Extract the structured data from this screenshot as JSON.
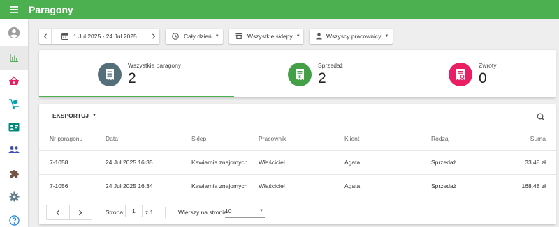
{
  "app": {
    "title": "Paragony"
  },
  "sidebar": {
    "items": [
      {
        "name": "account",
        "icon": "account-circle-icon",
        "active": false
      },
      {
        "name": "reports",
        "icon": "bar-chart-icon",
        "active": true
      },
      {
        "name": "sales",
        "icon": "shopping-basket-icon",
        "active": false
      },
      {
        "name": "delivery",
        "icon": "hand-truck-icon",
        "active": false
      },
      {
        "name": "customers",
        "icon": "contact-card-icon",
        "active": false
      },
      {
        "name": "employees",
        "icon": "people-icon",
        "active": false
      },
      {
        "name": "integrations",
        "icon": "puzzle-icon",
        "active": false
      },
      {
        "name": "settings",
        "icon": "gear-icon",
        "active": false
      },
      {
        "name": "help",
        "icon": "help-icon",
        "active": false
      }
    ]
  },
  "filters": {
    "date_range": "1 Jul 2025 - 24 Jul 2025",
    "time": "Cały dzień",
    "shops": "Wszystkie sklepy",
    "employees": "Wszyscy pracownicy"
  },
  "stats": {
    "all": {
      "label": "Wszystkie paragony",
      "value": "2",
      "color": "#546e7a"
    },
    "sales": {
      "label": "Sprzedaż",
      "value": "2",
      "color": "#43a047"
    },
    "returns": {
      "label": "Zwroty",
      "value": "0",
      "color": "#e91e63"
    }
  },
  "table": {
    "export_label": "EKSPORTUJ",
    "headers": {
      "number": "Nr paragonu",
      "date": "Data",
      "shop": "Sklep",
      "employee": "Pracownik",
      "client": "Klient",
      "type": "Rodzaj",
      "total": "Suma"
    },
    "rows": [
      {
        "number": "7-1058",
        "date": "24 Jul 2025 16:35",
        "shop": "Kawiarnia znajomych",
        "employee": "Właściciel",
        "client": "Agata",
        "type": "Sprzedaż",
        "total": "33,48 zł"
      },
      {
        "number": "7-1056",
        "date": "24 Jul 2025 16:34",
        "shop": "Kawiarnia znajomych",
        "employee": "Właściciel",
        "client": "Agata",
        "type": "Sprzedaż",
        "total": "168,48 zł"
      }
    ]
  },
  "pagination": {
    "page_label": "Strona:",
    "page_value": "1",
    "of_label": "z 1",
    "rows_label": "Wierszy na stronie:",
    "rows_value": "10"
  },
  "colors": {
    "accent": "#4caf50",
    "sales": "#43a047",
    "returns": "#e91e63",
    "all": "#546e7a"
  }
}
